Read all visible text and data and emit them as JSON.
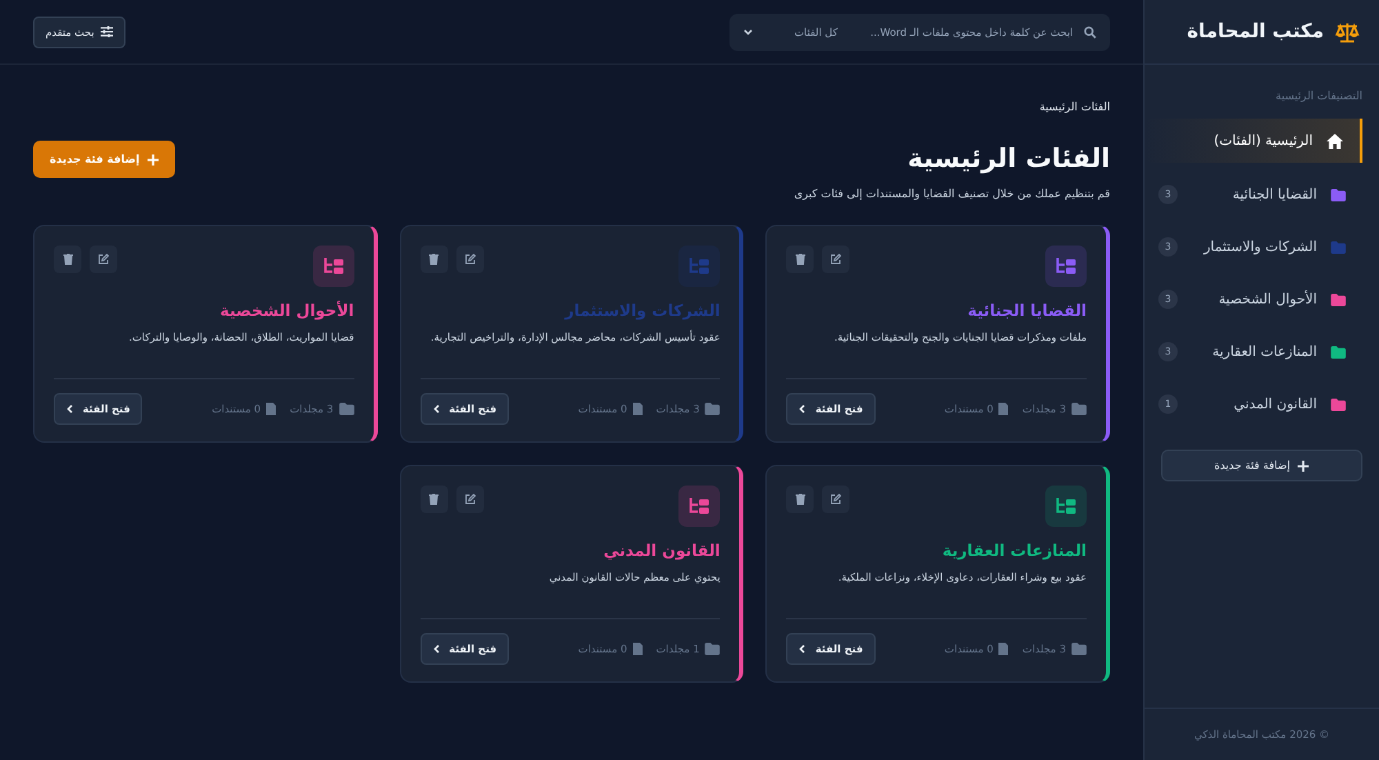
{
  "sidebar": {
    "brand": "مكتب المحاماة",
    "section_label": "التصنيفات الرئيسية",
    "items": [
      {
        "kind": "home",
        "label": "الرئيسية (الفئات)",
        "selected": true
      },
      {
        "kind": "category",
        "label": "القضايا الجنائية",
        "count": "3",
        "color": "#8b5cf6",
        "selected": false
      },
      {
        "kind": "category",
        "label": "الشركات والاستثمار",
        "count": "3",
        "color": "#1e3a8a",
        "selected": false
      },
      {
        "kind": "category",
        "label": "الأحوال الشخصية",
        "count": "3",
        "color": "#ec4899",
        "selected": false
      },
      {
        "kind": "category",
        "label": "المنازعات العقارية",
        "count": "3",
        "color": "#10b981",
        "selected": false
      },
      {
        "kind": "category",
        "label": "القانون المدني",
        "count": "1",
        "color": "#ec4899",
        "selected": false
      }
    ],
    "add_button": "إضافة فئة جديدة",
    "footer": "© 2026 مكتب المحاماة الذكي"
  },
  "topbar": {
    "search": {
      "placeholder": "ابحث عن كلمة داخل محتوى ملفات الـ Word..."
    },
    "filter": "كل الفئات",
    "advanced_button": "بحث متقدم"
  },
  "breadcrumb": "الفئات الرئيسية",
  "title": "الفئات الرئيسية",
  "subtitle": "قم بتنظيم عملك من خلال تصنيف القضايا والمستندات إلى فئات كبرى",
  "add_button": "إضافة فئة جديدة",
  "cards": [
    {
      "title": "القضايا الجنائية",
      "description": "ملفات ومذكرات قضايا الجنايات والجنح والتحقيقات الجنائية.",
      "folders": "3 مجلدات",
      "documents": "0 مستندات",
      "open_button": "فتح الفئة",
      "color": "#8b5cf6"
    },
    {
      "title": "الشركات والاستثمار",
      "description": "عقود تأسيس الشركات، محاضر مجالس الإدارة، والتراخيص التجارية.",
      "folders": "3 مجلدات",
      "documents": "0 مستندات",
      "open_button": "فتح الفئة",
      "color": "#1e3a8a"
    },
    {
      "title": "الأحوال الشخصية",
      "description": "قضايا المواريث، الطلاق، الحضانة، والوصايا والتركات.",
      "folders": "3 مجلدات",
      "documents": "0 مستندات",
      "open_button": "فتح الفئة",
      "color": "#ec4899"
    },
    {
      "title": "المنازعات العقارية",
      "description": "عقود بيع وشراء العقارات، دعاوى الإخلاء، ونزاعات الملكية.",
      "folders": "3 مجلدات",
      "documents": "0 مستندات",
      "open_button": "فتح الفئة",
      "color": "#10b981"
    },
    {
      "title": "القانون المدني",
      "description": "يحتوي على معظم حالات القانون المدني",
      "folders": "1 مجلدات",
      "documents": "0 مستندات",
      "open_button": "فتح الفئة",
      "color": "#ec4899"
    }
  ]
}
